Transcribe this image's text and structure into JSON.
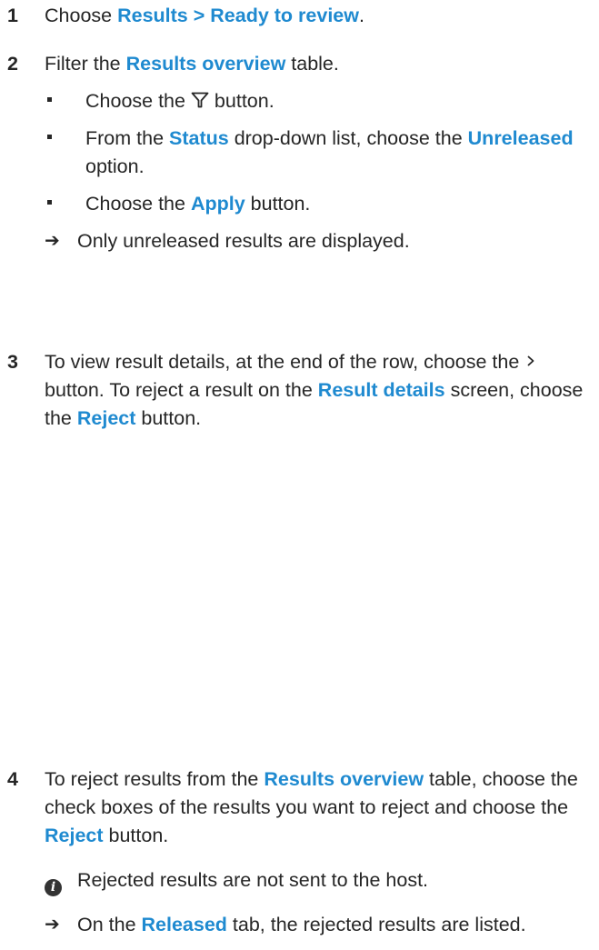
{
  "step1": {
    "num": "1",
    "pre": "Choose ",
    "menu": "Results > Ready to review",
    "post": "."
  },
  "step2": {
    "num": "2",
    "pre": "Filter the ",
    "table": "Results overview",
    "post": " table.",
    "bullet1": {
      "pre": "Choose the ",
      "icon": "filter-funnel-icon",
      "post": " button."
    },
    "bullet2": {
      "pre": "From the ",
      "list": "Status",
      "mid": " drop-down list, choose the ",
      "option": "Unreleased",
      "post": " option."
    },
    "bullet3": {
      "pre": "Choose the ",
      "button": "Apply",
      "post": " button."
    },
    "result": "Only unreleased results are displayed."
  },
  "step3": {
    "num": "3",
    "pre": "To view result details, at the end of the row, choose the ",
    "icon": "chevron-right-icon",
    "mid": " button. To reject a result on the ",
    "screen": "Result details",
    "mid2": " screen, choose the ",
    "button": "Reject",
    "post": " button."
  },
  "step4": {
    "num": "4",
    "pre": "To reject results from the ",
    "table": "Results overview",
    "mid": " table, choose the check boxes of the results you want to reject and choose the ",
    "button": "Reject",
    "post": " button.",
    "note_icon": "i",
    "note": "Rejected results are not sent to the host.",
    "result_pre": "On the ",
    "tab": "Released",
    "result_post": " tab, the rejected results are listed."
  },
  "colors": {
    "accent": "#1f8ad0",
    "text": "#262626"
  }
}
